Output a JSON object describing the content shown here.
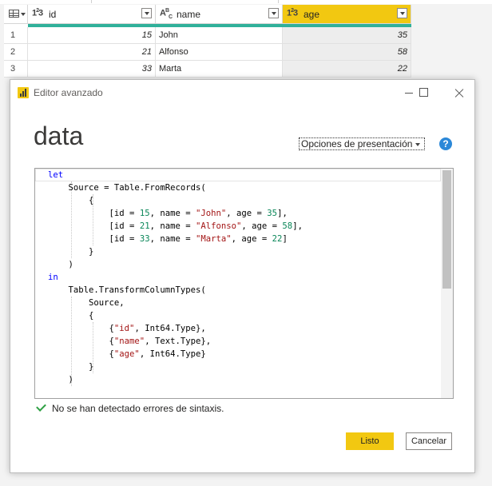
{
  "grid": {
    "columns": [
      {
        "type_icon": "1²3",
        "name": "id"
      },
      {
        "type_icon": "A^B_C",
        "name": "name"
      },
      {
        "type_icon": "1²3",
        "name": "age"
      }
    ],
    "rows": [
      {
        "n": "1",
        "id": "15",
        "name": "John",
        "age": "35"
      },
      {
        "n": "2",
        "id": "21",
        "name": "Alfonso",
        "age": "58"
      },
      {
        "n": "3",
        "id": "33",
        "name": "Marta",
        "age": "22"
      }
    ],
    "selected_column": "age",
    "quality_color": "#30b09a",
    "accent_color": "#f2c811"
  },
  "dialog": {
    "title": "Editor avanzado",
    "query_name": "data",
    "display_options": "Opciones de presentación",
    "help_icon": "question-icon",
    "code_lines": [
      "let",
      "    Source = Table.FromRecords(",
      "        {",
      "            [id = 15, name = \"John\", age = 35],",
      "            [id = 21, name = \"Alfonso\", age = 58],",
      "            [id = 33, name = \"Marta\", age = 22]",
      "        }",
      "    )",
      "in",
      "    Table.TransformColumnTypes(",
      "        Source,",
      "        {",
      "            {\"id\", Int64.Type},",
      "            {\"name\", Text.Type},",
      "            {\"age\", Int64.Type}",
      "        }",
      "    )"
    ],
    "status": "No se han detectado errores de sintaxis.",
    "ok_label": "Listo",
    "cancel_label": "Cancelar"
  }
}
